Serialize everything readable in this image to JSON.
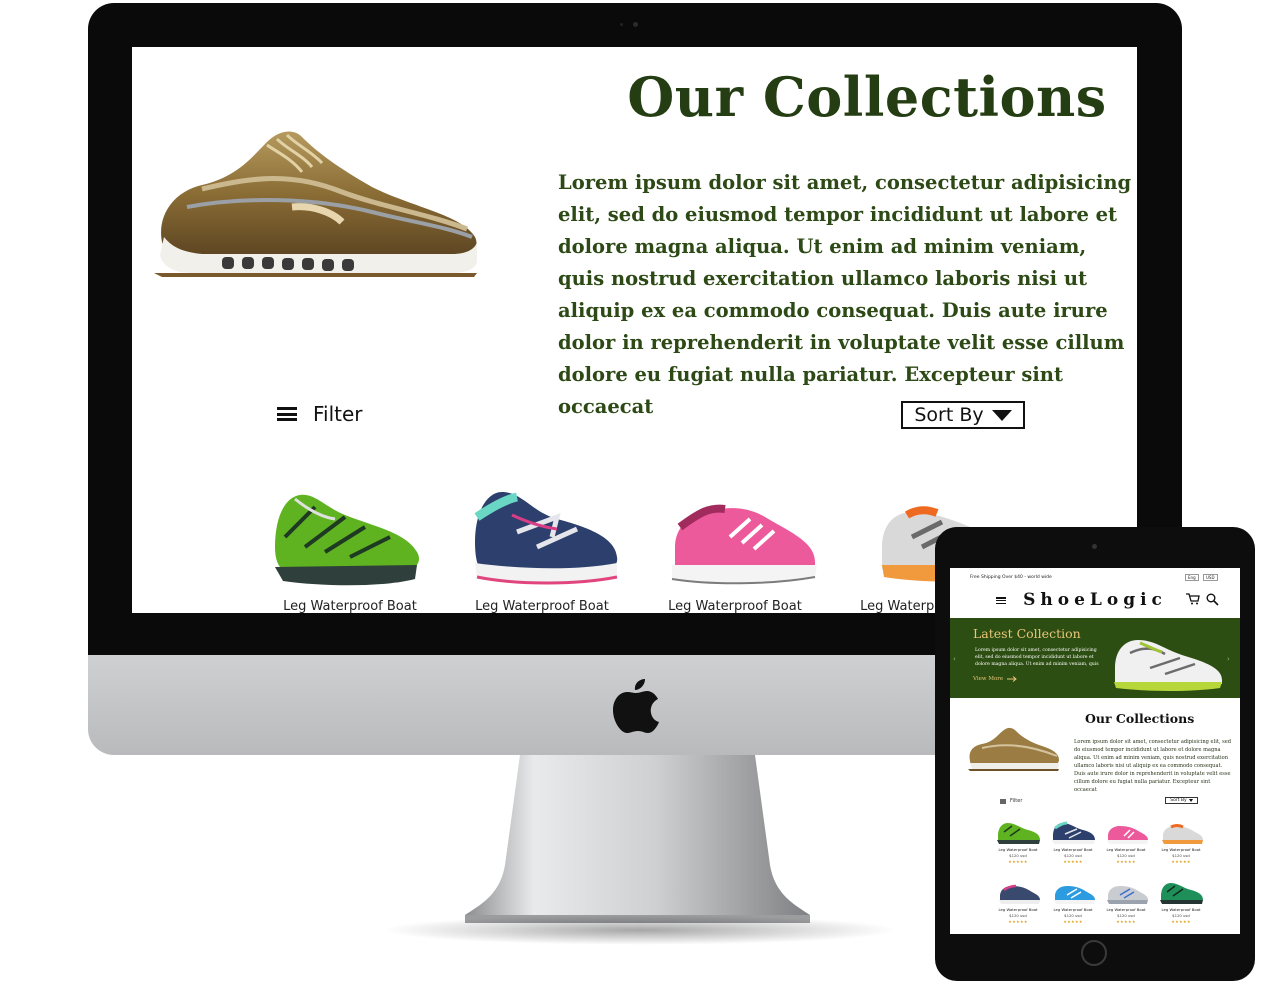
{
  "desktop": {
    "title": "Our Collections",
    "paragraph": "Lorem ipsum dolor sit amet, consectetur adipisicing elit, sed do eiusmod tempor incididunt ut labore et dolore magna aliqua. Ut enim ad minim veniam, quis nostrud exercitation ullamco laboris nisi ut aliquip ex ea commodo consequat. Duis aute irure dolor in reprehenderit in voluptate velit esse cillum dolore eu fugiat nulla pariatur. Excepteur sint occaecat",
    "filter_label": "Filter",
    "sort_label": "Sort By",
    "products": [
      {
        "name": "Leg Waterproof Boat"
      },
      {
        "name": "Leg Waterproof Boat"
      },
      {
        "name": "Leg Waterproof Boat"
      },
      {
        "name": "Leg Waterproof Boat"
      }
    ]
  },
  "tablet": {
    "shipping_text": "Free Shipping Over $40 - world wide",
    "language": "Eng",
    "currency": "USD",
    "brand": "ShoeLogic",
    "banner": {
      "title": "Latest Collection",
      "text": "Lorem ipsum dolor sit amet, consectetur adipisicing elit, sed do eiusmod tempor incididunt ut labore et dolore magna aliqua. Ut enim ad minim veniam, quis",
      "link": "View More"
    },
    "collections_title": "Our Collections",
    "collections_text": "Lorem ipsum dolor sit amet, consectetur adipisicing elit, sed do eiusmod tempor incididunt ut labore et dolore magna aliqua. Ut enim ad minim veniam, quis nostrud exercitation ullamco laboris nisi ut aliquip ex ea commodo consequat. Duis aute irure dolor in reprehenderit in voluptate velit esse cillum dolore eu fugiat nulla pariatur. Excepteur sint occaecat",
    "filter_label": "Filter",
    "sort_label": "Sort By",
    "products": [
      {
        "name": "Leg Waterproof Boat",
        "price": "$120 usd",
        "rating": "★★★★★"
      },
      {
        "name": "Leg Waterproof Boat",
        "price": "$120 usd",
        "rating": "★★★★★"
      },
      {
        "name": "Leg Waterproof Boat",
        "price": "$120 usd",
        "rating": "★★★★★"
      },
      {
        "name": "Leg Waterproof Boat",
        "price": "$120 usd",
        "rating": "★★★★★"
      },
      {
        "name": "Leg Waterproof Boat",
        "price": "$120 usd",
        "rating": "★★★★★"
      },
      {
        "name": "Leg Waterproof Boat",
        "price": "$120 usd",
        "rating": "★★★★★"
      },
      {
        "name": "Leg Waterproof Boat",
        "price": "$120 usd",
        "rating": "★★★★★"
      },
      {
        "name": "Leg Waterproof Boat",
        "price": "$120 usd",
        "rating": "★★★★★"
      }
    ]
  },
  "colors": {
    "brand_green": "#2d4e12",
    "title_green": "#243d12",
    "banner_gold": "#e9c57a",
    "star_gold": "#e0a323"
  },
  "icons": [
    "hamburger-icon",
    "caret-down-icon",
    "cart-icon",
    "search-icon",
    "arrow-right-icon",
    "apple-logo-icon"
  ]
}
